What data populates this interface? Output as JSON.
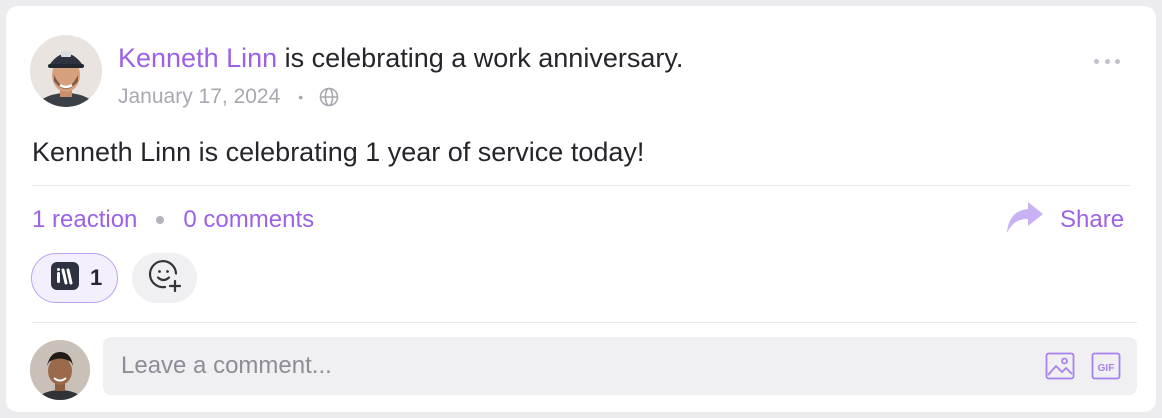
{
  "post": {
    "author": "Kenneth Linn",
    "action": "is celebrating a work anniversary.",
    "date": "January 17, 2024",
    "meta_dot": "•",
    "visibility_icon": "globe-icon",
    "body": "Kenneth Linn is celebrating 1 year of service today!"
  },
  "stats": {
    "reactions": "1 reaction",
    "comments": "0 comments",
    "share_label": "Share"
  },
  "reactions": [
    {
      "icon": "brand-logo-reaction-icon",
      "count": "1"
    }
  ],
  "comment": {
    "placeholder": "Leave a comment...",
    "image_icon": "image-icon",
    "gif_icon": "gif-icon",
    "gif_text": "GIF"
  },
  "colors": {
    "accent": "#9b62e8",
    "text": "#24262b",
    "muted": "#a7a8b0"
  }
}
